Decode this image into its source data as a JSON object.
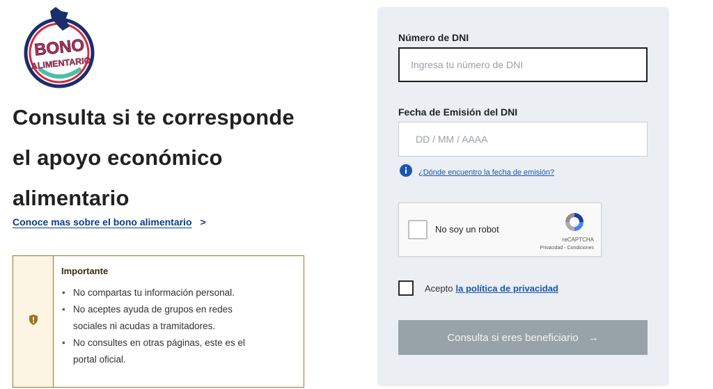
{
  "logo": {
    "line1": "BONO",
    "line2": "ALIMENTARIO"
  },
  "headline": {
    "line1": "Consulta si te corresponde",
    "line2": "el apoyo económico",
    "line3": "alimentario"
  },
  "learn_more": {
    "label": "Conoce mas sobre el bono alimentario",
    "chevron": ">"
  },
  "important": {
    "title": "Importante",
    "items": [
      {
        "line1": "No compartas tu información personal."
      },
      {
        "line1": "No aceptes ayuda de grupos en redes",
        "line2": "sociales ni acudas a tramitadores."
      },
      {
        "line1": "No consultes en otras páginas, este es el",
        "line2": "portal oficial."
      }
    ]
  },
  "form": {
    "dni_label": "Número de DNI",
    "dni_placeholder": "Ingresa tu número de DNI",
    "date_label": "Fecha de Emisión del DNI",
    "date_placeholder": "DD / MM / AAAA",
    "help_link": "¿Dónde encuentro la fecha de emisión?",
    "captcha": {
      "label": "No soy un robot",
      "brand": "reCAPTCHA",
      "links": "Privacidad - Condiciones"
    },
    "accept_text": "Acepto",
    "privacy_link": "la política de privacidad",
    "submit_label": "Consulta si eres beneficiario",
    "submit_arrow": "→"
  },
  "colors": {
    "panel_bg": "#ebeef3",
    "link_blue": "#1a56b0",
    "important_border": "#a0741d",
    "submit_disabled": "#97a3a8",
    "logo_red": "#d42a3a",
    "logo_navy": "#1b2e6b",
    "logo_teal": "#4bbfa8"
  },
  "icons": {
    "shield": "shield-icon",
    "info": "info-icon",
    "arrow": "arrow-right-icon",
    "recaptcha": "recaptcha-icon"
  }
}
